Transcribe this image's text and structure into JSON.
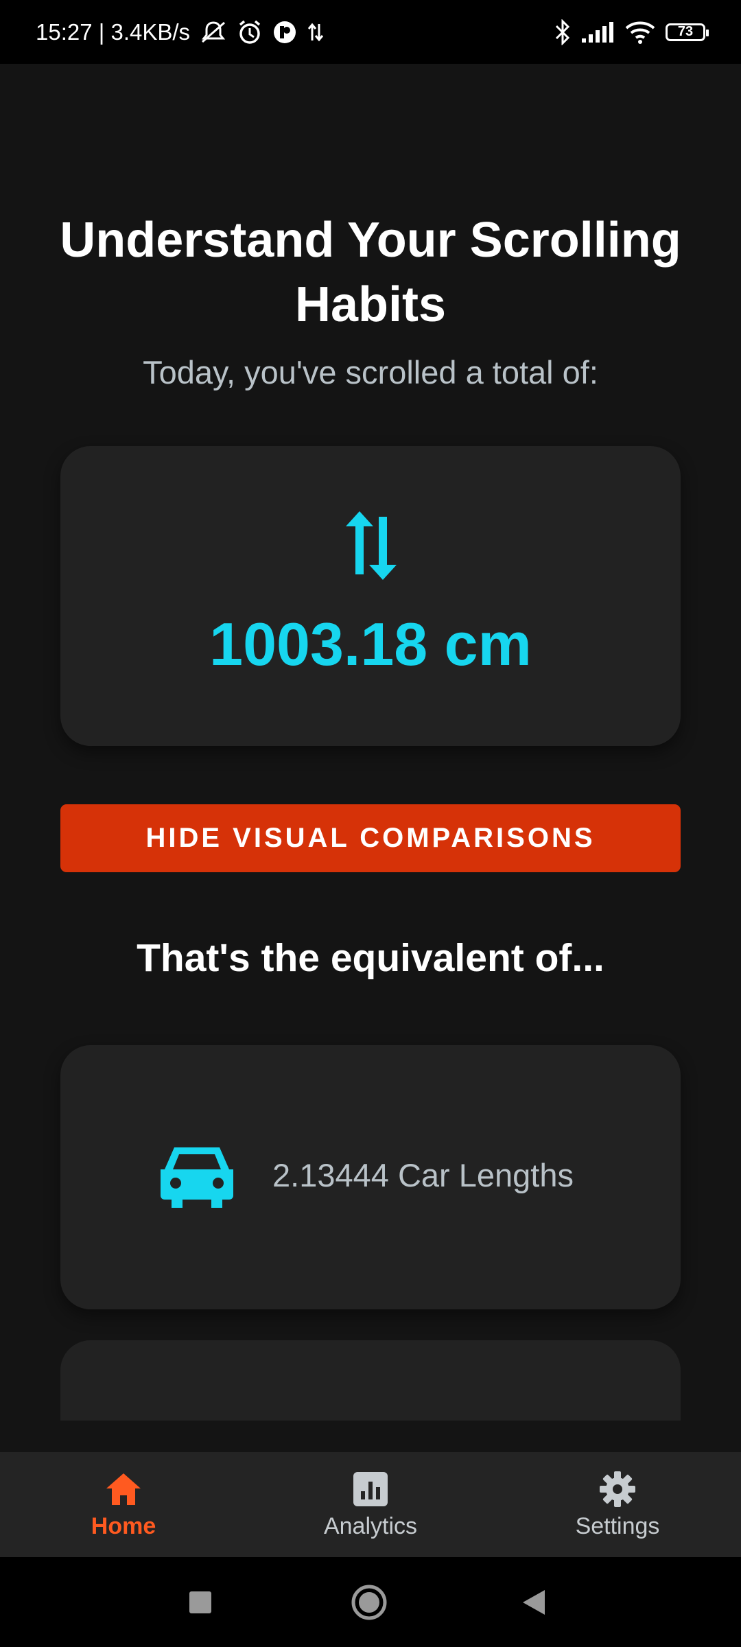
{
  "status_bar": {
    "time_speed": "15:27 | 3.4KB/s",
    "battery": "73",
    "icons": [
      "mute-icon",
      "alarm-icon",
      "app-icon",
      "data-arrows-icon",
      "bluetooth-icon",
      "signal-icon",
      "wifi-icon",
      "battery-icon"
    ]
  },
  "main": {
    "title": "Understand Your Scrolling Habits",
    "subtitle": "Today, you've scrolled a total of:",
    "total_value": "1003.18 cm",
    "total_icon": "vertical-swap-arrows-icon",
    "hide_button_label": "HIDE VISUAL COMPARISONS",
    "equivalent_heading": "That's the equivalent of...",
    "comparisons": [
      {
        "icon": "car-icon",
        "label": "2.13444 Car Lengths"
      }
    ]
  },
  "bottom_nav": {
    "items": [
      {
        "label": "Home",
        "icon": "home-icon",
        "active": true
      },
      {
        "label": "Analytics",
        "icon": "analytics-icon",
        "active": false
      },
      {
        "label": "Settings",
        "icon": "gear-icon",
        "active": false
      }
    ]
  },
  "colors": {
    "background": "#141414",
    "card": "#222222",
    "accent_cyan": "#17d6ef",
    "button": "#d63208",
    "nav_active": "#ff5a20",
    "nav_inactive": "#c7ccd0"
  }
}
